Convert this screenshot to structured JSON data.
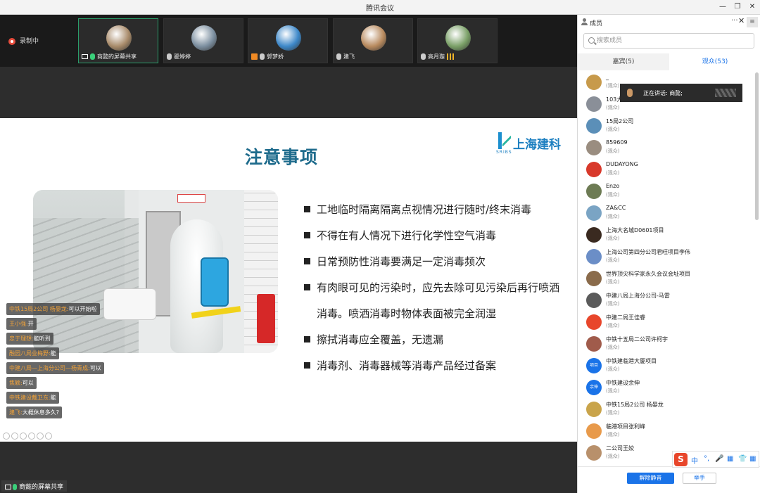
{
  "window": {
    "title": "腾讯会议"
  },
  "recording": {
    "label": "录制中"
  },
  "thumbnails": [
    {
      "name": "商懿的屏幕共享",
      "color": "#a88b6a"
    },
    {
      "name": "翟婷婷",
      "color": "#7c8fa0"
    },
    {
      "name": "郭梦娇",
      "color": "#3d88c9"
    },
    {
      "name": "建飞",
      "color": "#b88a5e"
    },
    {
      "name": "高月璇",
      "color": "#7aa067"
    }
  ],
  "slide": {
    "title": "注意事项",
    "logo_text": "上海建科",
    "logo_sub": "SRIBS",
    "bullets": [
      "工地临时隔离隔离点视情况进行随时/终末消毒",
      "不得在有人情况下进行化学性空气消毒",
      "日常预防性消毒要满足一定消毒频次",
      "有肉眼可见的污染时，应先去除可见污染后再行喷洒"
    ],
    "bullet4_cont": "消毒。喷洒消毒时物体表面被完全润湿",
    "bullets_after": [
      "擦拭消毒应全覆盖，无遗漏",
      "消毒剂、消毒器械等消毒产品经过备案"
    ]
  },
  "chat": [
    {
      "name": "中铁15局2公司 杨晏龙:",
      "text": "可以开始啦"
    },
    {
      "name": "王小强:",
      "text": "开"
    },
    {
      "name": "忠于理想:",
      "text": "能听到"
    },
    {
      "name": "融园八局业梅野:",
      "text": "能"
    },
    {
      "name": "中建八局—上海分公司—杨青成:",
      "text": "可以"
    },
    {
      "name": "焦颖:",
      "text": "可以"
    },
    {
      "name": "中铁建设戴卫东:",
      "text": "能"
    },
    {
      "name": "建飞:",
      "text": "大概休息多久?"
    }
  ],
  "share_label": "商懿的屏幕共享",
  "panel": {
    "title": "成员",
    "more": "···",
    "close": "✕",
    "menu": "≡",
    "search_placeholder": "搜索成员",
    "tab_guests": "嘉宾(5)",
    "tab_audience": "观众(53)",
    "role": "(观众)",
    "members": [
      {
        "name": "_",
        "avatar": "",
        "color": "#c79a4b"
      },
      {
        "name": "103大",
        "avatar": "",
        "color": "#8a8f98"
      },
      {
        "name": "15局2公司",
        "avatar": "",
        "color": "#5b8fb8"
      },
      {
        "name": "859609",
        "avatar": "",
        "color": "#9a8d80"
      },
      {
        "name": "DUDAYONG",
        "avatar": "",
        "color": "#d8392b"
      },
      {
        "name": "Enzo",
        "avatar": "",
        "color": "#6d7b54"
      },
      {
        "name": "ZA&CC",
        "avatar": "",
        "color": "#7aa4c4"
      },
      {
        "name": "上海大名城D0601项目",
        "avatar": "",
        "color": "#3a2a20"
      },
      {
        "name": "上海公司第四分公司君旺项目李伟",
        "avatar": "",
        "color": "#6b8ec7"
      },
      {
        "name": "世界顶尖科学家永久会议会址项目",
        "avatar": "",
        "color": "#8a6b4b"
      },
      {
        "name": "中建八局上海分公司-马雷",
        "avatar": "",
        "color": "#5b5b5b"
      },
      {
        "name": "中建二局王佳睿",
        "avatar": "",
        "color": "#e8462b"
      },
      {
        "name": "中铁十五局二公司许柯宇",
        "avatar": "",
        "color": "#a05b4b"
      },
      {
        "name": "中铁建临港大厦项目",
        "avatar": "项目",
        "color": "#1a73e8"
      },
      {
        "name": "中铁建设余伸",
        "avatar": "余伸",
        "color": "#1a73e8"
      },
      {
        "name": "中铁15局2公司 杨晏龙",
        "avatar": "",
        "color": "#c9a44b"
      },
      {
        "name": "临港项目张利峰",
        "avatar": "",
        "color": "#e89a4b"
      },
      {
        "name": "二公司王姣",
        "avatar": "",
        "color": "#b8906b"
      }
    ],
    "speaking": "正在讲话: 商懿;",
    "unmute": "解除静音",
    "raise_hand": "举手"
  },
  "ime": {
    "logo": "S",
    "items": [
      "中",
      "°,",
      "🎤",
      "▦",
      "👕",
      "▦"
    ]
  }
}
